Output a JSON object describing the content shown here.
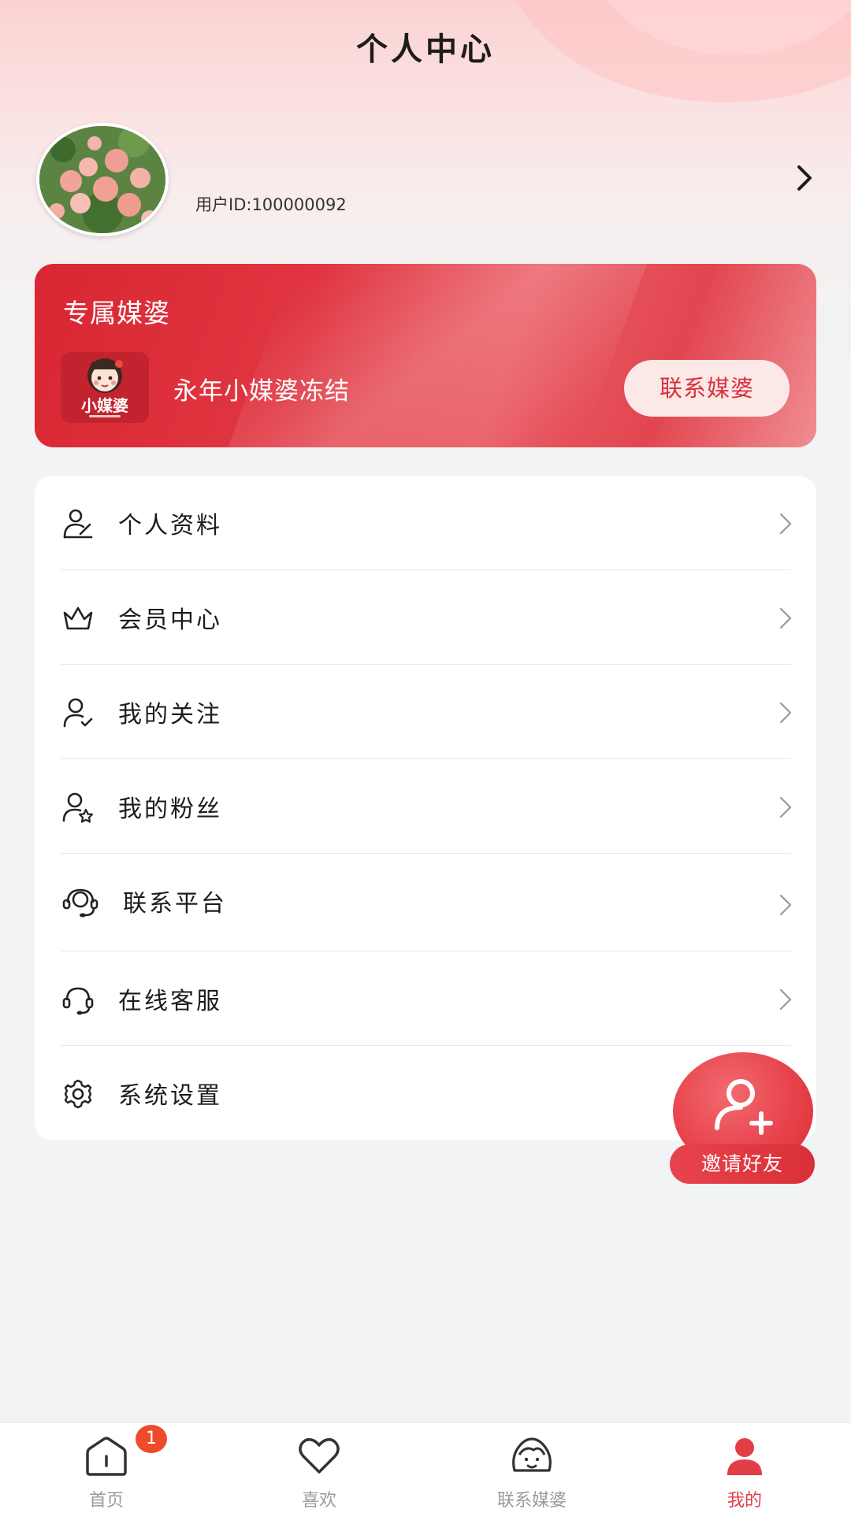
{
  "header": {
    "title": "个人中心"
  },
  "profile": {
    "user_id": "用户ID:100000092"
  },
  "matchmaker": {
    "section_title": "专属媒婆",
    "logo_text": "小媒婆",
    "name": "永年小媒婆冻结",
    "contact_button": "联系媒婆"
  },
  "menu": {
    "items": [
      {
        "label": "个人资料",
        "icon": "profile-edit-icon"
      },
      {
        "label": "会员中心",
        "icon": "crown-icon"
      },
      {
        "label": "我的关注",
        "icon": "user-check-icon"
      },
      {
        "label": "我的粉丝",
        "icon": "user-star-icon"
      },
      {
        "label": "联系平台",
        "icon": "headset-person-icon"
      },
      {
        "label": "在线客服",
        "icon": "headset-icon"
      },
      {
        "label": "系统设置",
        "icon": "gear-icon"
      }
    ]
  },
  "invite": {
    "label": "邀请好友"
  },
  "bottom_nav": {
    "items": [
      {
        "label": "首页",
        "icon": "home-icon",
        "badge": "1"
      },
      {
        "label": "喜欢",
        "icon": "heart-icon"
      },
      {
        "label": "联系媒婆",
        "icon": "matchmaker-face-icon"
      },
      {
        "label": "我的",
        "icon": "person-icon",
        "active": true
      }
    ]
  },
  "colors": {
    "accent": "#e23e48",
    "card_red": "#d92632",
    "badge": "#ee4b2b"
  }
}
